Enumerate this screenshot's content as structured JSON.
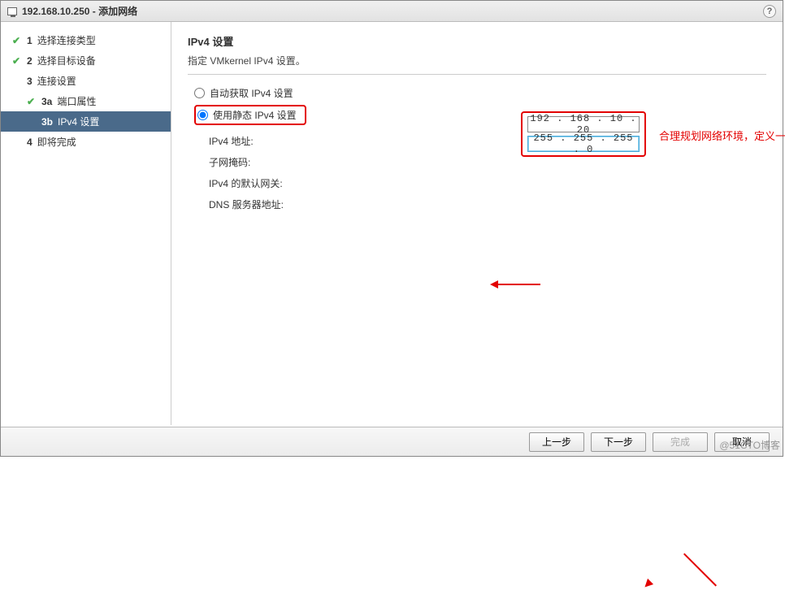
{
  "window": {
    "title": "192.168.10.250 - 添加网络"
  },
  "sidebar": {
    "items": [
      {
        "num": "1",
        "label": "选择连接类型",
        "check": "✔"
      },
      {
        "num": "2",
        "label": "选择目标设备",
        "check": "✔"
      },
      {
        "num": "3",
        "label": "连接设置",
        "check": ""
      },
      {
        "num": "3a",
        "label": "端口属性",
        "check": "✔"
      },
      {
        "num": "3b",
        "label": "IPv4 设置",
        "check": ""
      },
      {
        "num": "4",
        "label": "即将完成",
        "check": ""
      }
    ]
  },
  "content": {
    "heading": "IPv4 设置",
    "subheading": "指定 VMkernel IPv4 设置。",
    "radio_auto": "自动获取 IPv4 设置",
    "radio_static": "使用静态 IPv4 设置",
    "labels": {
      "ipv4addr": "IPv4 地址:",
      "subnet": "子网掩码:",
      "gateway": "IPv4 的默认网关:",
      "dns": "DNS 服务器地址:"
    },
    "values": {
      "ipv4addr": "192 . 168 .  10 .  20",
      "subnet": "255 . 255 . 255 .   0"
    },
    "annotation": "合理规划网络环境，定义一个静态的IP地址"
  },
  "footer": {
    "prev": "上一步",
    "next": "下一步",
    "finish": "完成",
    "cancel": "取消"
  },
  "watermark": "@51CTO博客",
  "help": "?"
}
